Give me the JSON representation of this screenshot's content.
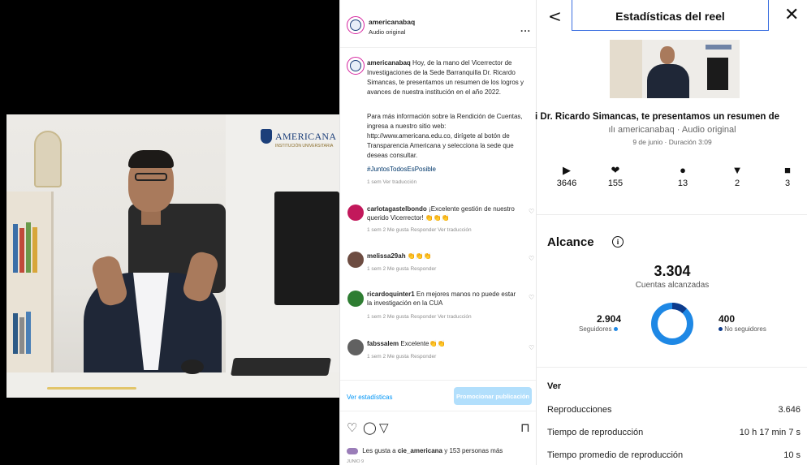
{
  "video": {
    "brand_name": "AMERICANA",
    "brand_sub": "INSTITUCIÓN UNIVERSITARIA"
  },
  "post": {
    "username": "americanabaq",
    "audio": "Audio original",
    "more": "...",
    "caption_user": "americanabaq",
    "caption_text": "Hoy, de la mano del Vicerrector de Investigaciones de la Sede Barranquilla Dr. Ricardo Simancas, te presentamos un resumen de los logros y avances de nuestra institución en el año 2022.",
    "caption_more": "Para más información sobre la Rendición de Cuentas, ingresa a nuestro sitio web: http://www.americana.edu.co, dirígete al botón de Transparencia Americana y selecciona la sede que deseas consultar.",
    "hashtag": "#JuntosTodosEsPosible",
    "caption_meta": "1 sem   Ver traducción",
    "comments": [
      {
        "user": "carlotagastelbondo",
        "text": "¡Excelente gestión de nuestro querido Vicerrector! 👏👏👏",
        "meta": "1 sem   2 Me gusta   Responder   Ver traducción",
        "color": "#c2185b"
      },
      {
        "user": "melissa29ah",
        "text": "👏👏👏",
        "meta": "1 sem   2 Me gusta   Responder",
        "color": "#6d4c41"
      },
      {
        "user": "ricardoquinter1",
        "text": "En mejores manos no puede estar la investigación en la CUA",
        "meta": "1 sem   2 Me gusta   Responder   Ver traducción",
        "color": "#2e7d32"
      },
      {
        "user": "fabssalem",
        "text": "Excelente👏👏",
        "meta": "1 sem   2 Me gusta   Responder",
        "color": "#616161"
      }
    ],
    "view_stats_link": "Ver estadísticas",
    "promote_button": "Promocionar publicación",
    "likes_prefix": "Les gusta a",
    "likes_user": "cie_americana",
    "likes_suffix": "y 153 personas más",
    "date": "JUNIO 9",
    "icons": [
      "heart-icon",
      "comment-icon",
      "share-icon",
      "bookmark-icon"
    ]
  },
  "stats": {
    "title": "Estadísticas del reel",
    "back": "<",
    "close": "✕",
    "reel_caption": "i Dr. Ricardo Simancas, te presentamos un resumen de",
    "audio_line": "ılı americanabaq · Audio original",
    "date_line": "9 de junio · Duración 3:09",
    "metrics": [
      {
        "icon": "play-icon",
        "glyph": "▶",
        "value": "3646"
      },
      {
        "icon": "heart-icon",
        "glyph": "❤",
        "value": "155"
      },
      {
        "icon": "comment-icon",
        "glyph": "●",
        "value": "13"
      },
      {
        "icon": "share-icon",
        "glyph": "▼",
        "value": "2"
      },
      {
        "icon": "bookmark-icon",
        "glyph": "■",
        "value": "3"
      }
    ],
    "alcance": {
      "title": "Alcance",
      "info": "i",
      "total": "3.304",
      "total_label": "Cuentas alcanzadas",
      "followers": "2.904",
      "followers_label": "Seguidores",
      "followers_fraction": 0.879,
      "non_followers": "400",
      "non_followers_label": "No seguidores",
      "non_followers_fraction": 0.121,
      "followers_color": "#1e88e5",
      "non_followers_color": "#0d3b8c"
    },
    "ver": {
      "title": "Ver",
      "rows": [
        {
          "label": "Reproducciones",
          "value": "3.646"
        },
        {
          "label": "Tiempo de reproducción",
          "value": "10 h 17 min 7 s"
        },
        {
          "label": "Tiempo promedio de reproducción",
          "value": "10 s"
        }
      ]
    }
  }
}
